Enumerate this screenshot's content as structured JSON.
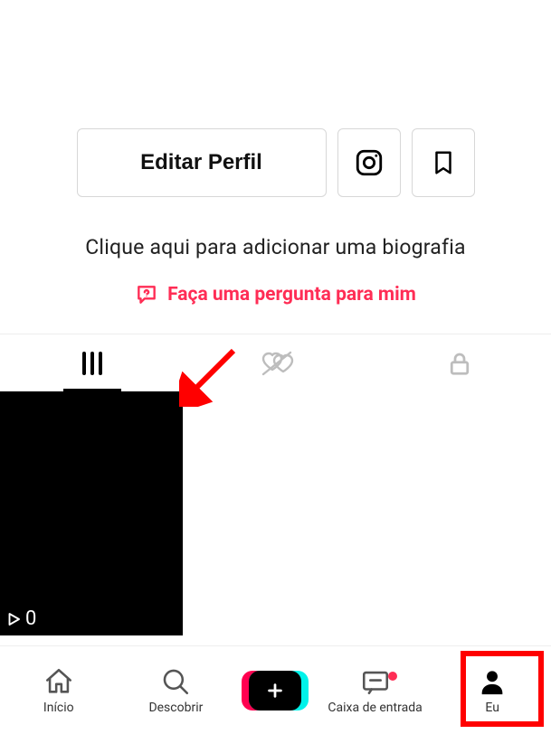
{
  "actions": {
    "edit_label": "Editar Perfil"
  },
  "bio": {
    "placeholder_text": "Clique aqui para adicionar uma biografia",
    "ask_label": "Faça uma pergunta para mim"
  },
  "thumbnail": {
    "play_count": "0"
  },
  "nav": {
    "home": "Início",
    "discover": "Descobrir",
    "inbox": "Caixa de entrada",
    "me": "Eu"
  }
}
